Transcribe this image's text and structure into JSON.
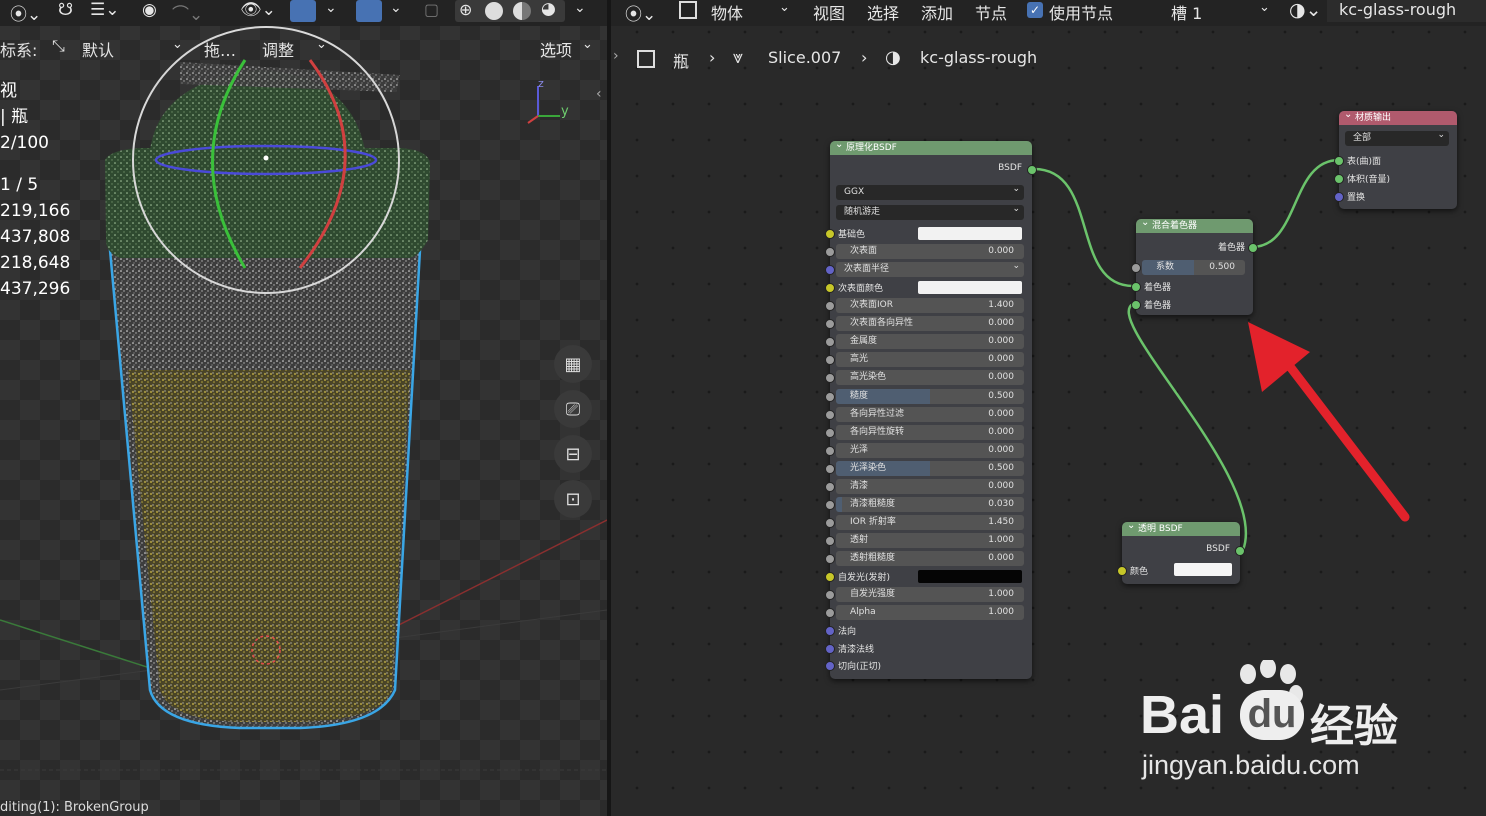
{
  "viewport": {
    "header": {
      "shading_icons": [
        "wireframe-icon",
        "solid-icon",
        "material-icon",
        "rendered-icon"
      ]
    },
    "sub": {
      "coord_label": "标系:",
      "coord_value": "默认",
      "drag_label": "拖…",
      "adjust_label": "调整",
      "options_label": "选项"
    },
    "overlay": {
      "line1": "视",
      "line2": "| 瓶",
      "line3": "2/100",
      "line4": "1 / 5",
      "line5": "219,166",
      "line6": "437,808",
      "line7": "218,648",
      "line8": "437,296"
    },
    "axis": {
      "z": "z",
      "y": "y"
    },
    "status": "diting(1): BrokenGroup"
  },
  "node_editor": {
    "header": {
      "object_label": "物体",
      "view_label": "视图",
      "select_label": "选择",
      "add_label": "添加",
      "node_label": "节点",
      "use_nodes_label": "使用节点",
      "slot_label": "槽 1",
      "material_name": "kc-glass-rough"
    },
    "breadcrumb": {
      "object": "瓶",
      "mesh": "Slice.007",
      "material": "kc-glass-rough"
    },
    "principled": {
      "title": "原理化BSDF",
      "output": "BSDF",
      "distribution": "GGX",
      "subsurface_method": "随机游走",
      "base_color_label": "基础色",
      "subsurface_label": "次表面",
      "subsurface_value": "0.000",
      "subsurface_radius_label": "次表面半径",
      "subsurface_color_label": "次表面颜色",
      "rows": [
        {
          "label": "次表面IOR",
          "value": "1.400"
        },
        {
          "label": "次表面各向异性",
          "value": "0.000"
        },
        {
          "label": "金属度",
          "value": "0.000"
        },
        {
          "label": "高光",
          "value": "0.000"
        },
        {
          "label": "高光染色",
          "value": "0.000"
        },
        {
          "label": "糙度",
          "value": "0.500"
        },
        {
          "label": "各向异性过滤",
          "value": "0.000"
        },
        {
          "label": "各向异性旋转",
          "value": "0.000"
        },
        {
          "label": "光泽",
          "value": "0.000"
        },
        {
          "label": "光泽染色",
          "value": "0.500"
        },
        {
          "label": "清漆",
          "value": "0.000"
        },
        {
          "label": "清漆粗糙度",
          "value": "0.030"
        },
        {
          "label": "IOR 折射率",
          "value": "1.450"
        },
        {
          "label": "透射",
          "value": "1.000"
        },
        {
          "label": "透射粗糙度",
          "value": "0.000"
        }
      ],
      "emission_label": "自发光(发射)",
      "rows2": [
        {
          "label": "自发光强度",
          "value": "1.000"
        },
        {
          "label": "Alpha",
          "value": "1.000"
        }
      ],
      "normal_label": "法向",
      "clearcoat_normal_label": "清漆法线",
      "tangent_label": "切向(正切)"
    },
    "mix": {
      "title": "混合着色器",
      "output": "着色器",
      "fac_label": "系数",
      "fac_value": "0.500",
      "shader1": "着色器",
      "shader2": "着色器"
    },
    "transparent": {
      "title": "透明 BSDF",
      "output": "BSDF",
      "color_label": "颜色"
    },
    "output": {
      "title": "材质输出",
      "target": "全部",
      "surface": "表(曲)面",
      "volume": "体积(音量)",
      "displacement": "置换"
    }
  },
  "watermark": {
    "brand_a": "Bai",
    "brand_b": "du",
    "brand_cn": "经验",
    "url": "jingyan.baidu.com"
  },
  "colors": {
    "shader_header": "#6f9a6f",
    "output_header": "#b05a6d",
    "arrow": "#e3222b",
    "link": "#6bc36b"
  }
}
